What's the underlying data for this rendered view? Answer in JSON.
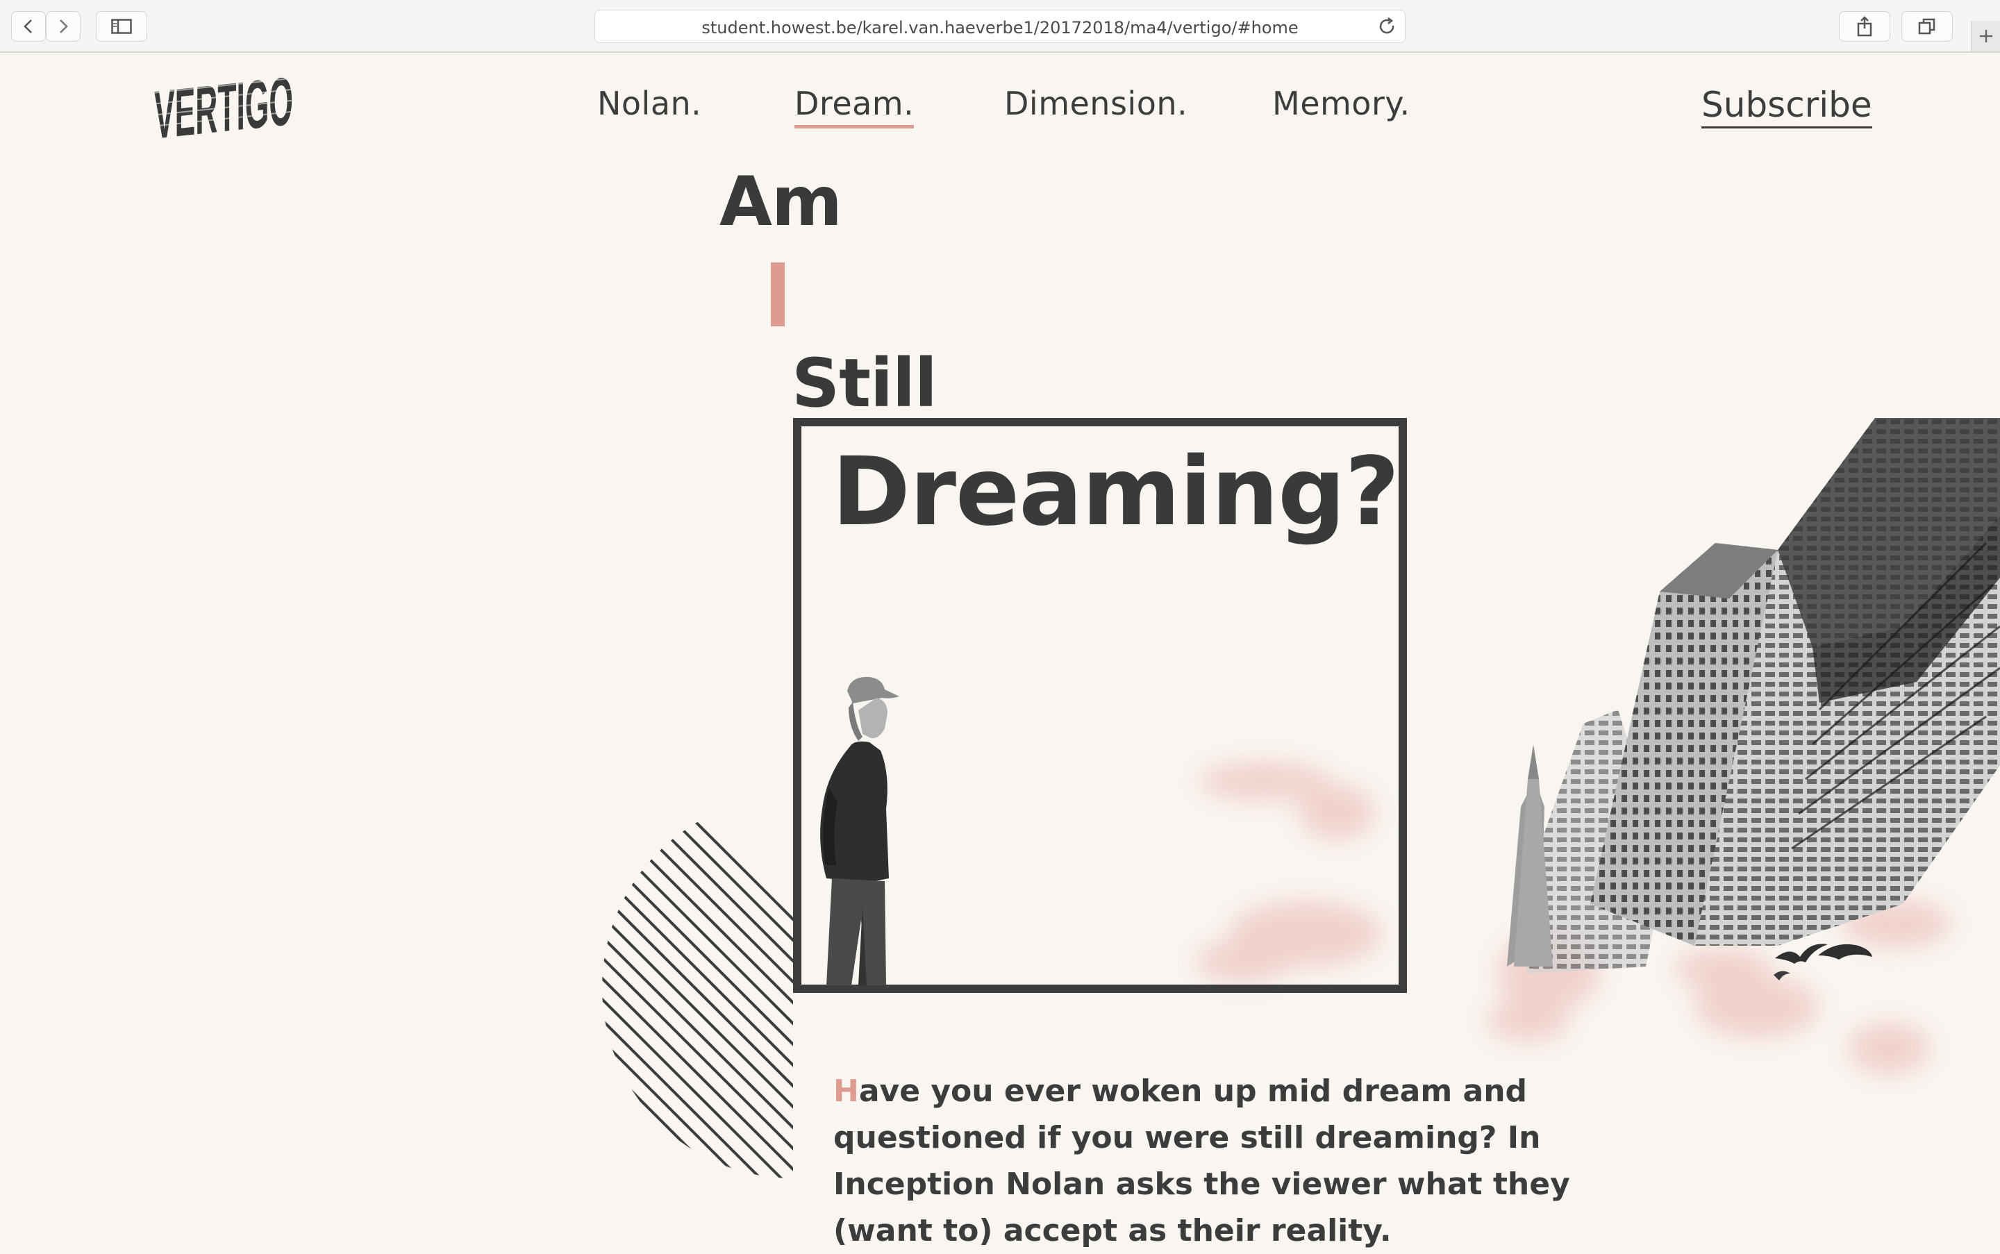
{
  "browser": {
    "url": "student.howest.be/karel.van.haeverbe1/20172018/ma4/vertigo/#home",
    "icons": [
      "back-icon",
      "forward-icon",
      "sidebar-icon",
      "reload-icon",
      "share-icon",
      "tabs-icon",
      "new-tab-icon"
    ]
  },
  "site": {
    "logo": "VERTIGO",
    "nav": [
      {
        "label": "Nolan."
      },
      {
        "label": "Dream.",
        "active": true
      },
      {
        "label": "Dimension."
      },
      {
        "label": "Memory."
      }
    ],
    "subscribe": "Subscribe"
  },
  "hero": {
    "word_am": "Am",
    "word_i": "I",
    "word_still": "Still",
    "word_dreaming": "Dreaming?",
    "intro_initial": "H",
    "intro_rest": "ave you ever woken up mid dream and questioned if you were still dreaming? In Inception Nolan asks the viewer what they (want to) accept as their reality."
  },
  "colors": {
    "accent": "#de9c90",
    "background": "#f9f6f2",
    "text": "#3a3a3a"
  }
}
